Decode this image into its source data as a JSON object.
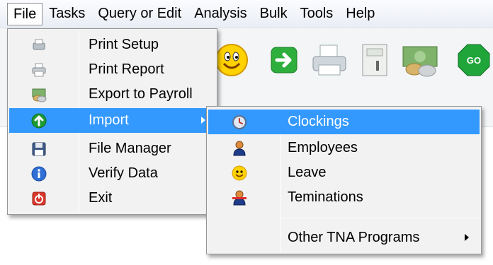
{
  "menubar": {
    "items": [
      {
        "label": "File"
      },
      {
        "label": "Tasks"
      },
      {
        "label": "Query or Edit"
      },
      {
        "label": "Analysis"
      },
      {
        "label": "Bulk"
      },
      {
        "label": "Tools"
      },
      {
        "label": "Help"
      }
    ]
  },
  "toolbar": {
    "go_label": "GO",
    "icons": [
      "smiley-icon",
      "green-arrow-icon",
      "printer-icon",
      "calculator-icon",
      "money-icon",
      "go-icon"
    ]
  },
  "file_menu": {
    "items": [
      {
        "label": "Print Setup",
        "icon": "printer-setup-icon"
      },
      {
        "label": "Print Report",
        "icon": "printer-icon"
      },
      {
        "label": "Export to Payroll",
        "icon": "money-icon"
      },
      {
        "label": "Import",
        "icon": "green-up-arrow-icon"
      },
      {
        "label": "File Manager",
        "icon": "disk-icon"
      },
      {
        "label": "Verify Data",
        "icon": "info-icon"
      },
      {
        "label": "Exit",
        "icon": "exit-icon"
      }
    ]
  },
  "import_menu": {
    "items": [
      {
        "label": "Clockings",
        "icon": "clock-icon"
      },
      {
        "label": "Employees",
        "icon": "employee-icon"
      },
      {
        "label": "Leave",
        "icon": "smiley-icon"
      },
      {
        "label": "Teminations",
        "icon": "termination-icon"
      }
    ],
    "other_label": "Other TNA Programs"
  },
  "colors": {
    "highlight": "#3399ff",
    "menu_bg": "#f2f2f2"
  }
}
